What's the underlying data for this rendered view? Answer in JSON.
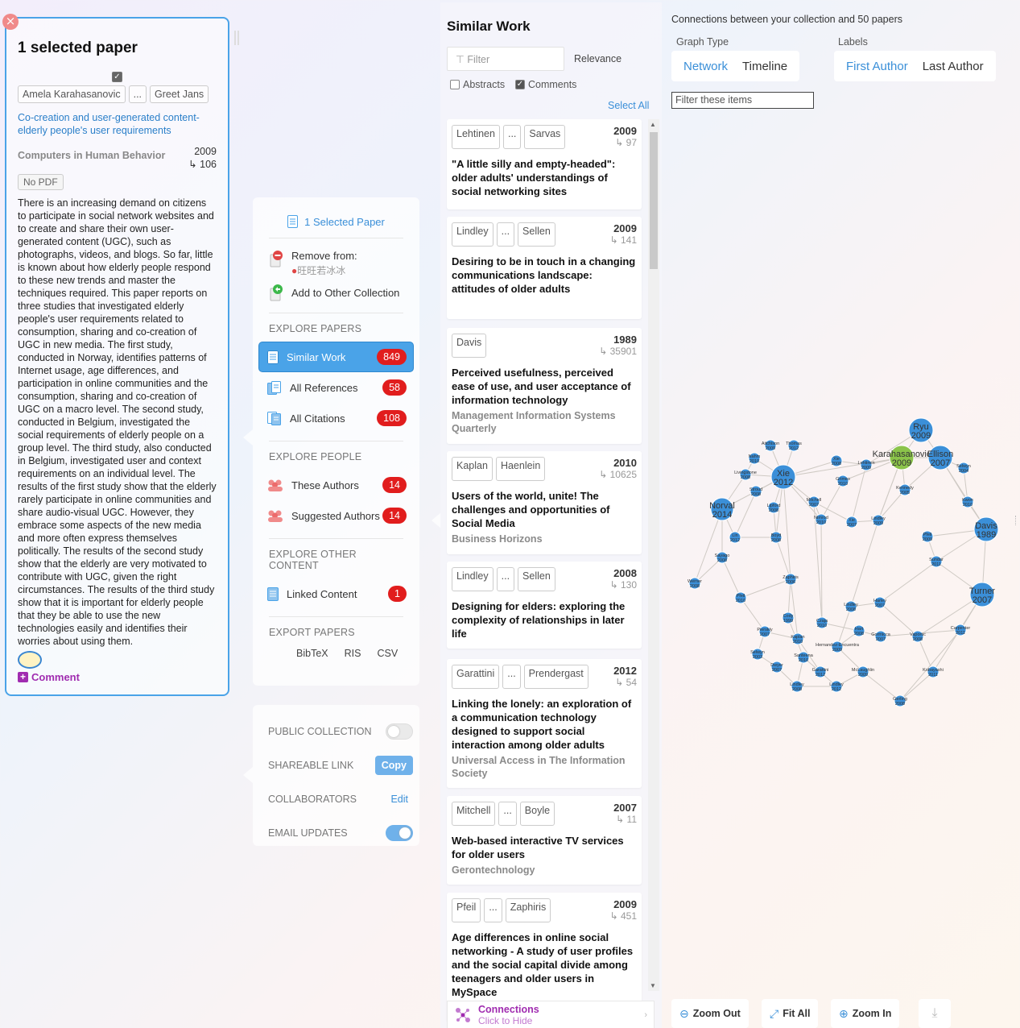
{
  "selected": {
    "title": "1 selected paper",
    "authors": [
      "Amela Karahasanovic",
      "...",
      "Greet Jans"
    ],
    "paper_title": "Co-creation and user-generated content-elderly people's user requirements",
    "journal": "Computers in Human Behavior",
    "year": "2009",
    "citations": "106",
    "no_pdf": "No PDF",
    "abstract": "There is an increasing demand on citizens to participate in social network websites and to create and share their own user-generated content (UGC), such as photographs, videos, and blogs. So far, little is known about how elderly people respond to these new trends and master the techniques required. This paper reports on three studies that investigated elderly people's user requirements related to consumption, sharing and co-creation of UGC in new media. The first study, conducted in Norway, identifies patterns of Internet usage, age differences, and participation in online communities and the consumption, sharing and co-creation of UGC on a macro level. The second study, conducted in Belgium, investigated the social requirements of elderly people on a group level. The third study, also conducted in Belgium, investigated user and context requirements on an individual level. The results of the first study show that the elderly rarely participate in online communities and share audio-visual UGC. However, they embrace some aspects of the new media and more often express themselves politically. The results of the second study show that the elderly are very motivated to contribute with UGC, given the right circumstances. The results of the third study show that it is important for elderly people that they be able to use the new technologies easily and identifies their worries about using them.",
    "comment_label": "Comment"
  },
  "menu": {
    "selected_paper": "1 Selected Paper",
    "remove_from": "Remove from:",
    "collection_name": "旺旺若冰冰",
    "add_to_other": "Add to Other Collection",
    "explore_papers_title": "EXPLORE PAPERS",
    "similar_work": {
      "label": "Similar Work",
      "count": "849"
    },
    "all_references": {
      "label": "All References",
      "count": "58"
    },
    "all_citations": {
      "label": "All Citations",
      "count": "108"
    },
    "explore_people_title": "EXPLORE PEOPLE",
    "these_authors": {
      "label": "These Authors",
      "count": "14"
    },
    "suggested_authors": {
      "label": "Suggested Authors",
      "count": "14"
    },
    "explore_other_title": "EXPLORE OTHER CONTENT",
    "linked_content": {
      "label": "Linked Content",
      "count": "1"
    },
    "export_title": "EXPORT PAPERS",
    "export_formats": [
      "BibTeX",
      "RIS",
      "CSV"
    ]
  },
  "settings": {
    "public_collection": "PUBLIC COLLECTION",
    "public_on": false,
    "shareable_link": "SHAREABLE LINK",
    "copy": "Copy",
    "collaborators": "COLLABORATORS",
    "edit": "Edit",
    "email_updates": "EMAIL UPDATES",
    "email_on": true
  },
  "similar": {
    "title": "Similar Work",
    "filter_placeholder": "Filter",
    "sort": "Relevance",
    "abstracts": "Abstracts",
    "abstracts_checked": false,
    "comments": "Comments",
    "comments_checked": true,
    "select_all": "Select All",
    "papers": [
      {
        "authors": [
          "Lehtinen",
          "...",
          "Sarvas"
        ],
        "year": "2009",
        "cites": "97",
        "title": "\"A little silly and empty-headed\": older adults' understandings of social networking sites",
        "journal": ""
      },
      {
        "authors": [
          "Lindley",
          "...",
          "Sellen"
        ],
        "year": "2009",
        "cites": "141",
        "title": "Desiring to be in touch in a changing communications landscape: attitudes of older adults",
        "journal": ""
      },
      {
        "authors": [
          "Davis"
        ],
        "year": "1989",
        "cites": "35901",
        "title": "Perceived usefulness, perceived ease of use, and user acceptance of information technology",
        "journal": "Management Information Systems Quarterly"
      },
      {
        "authors": [
          "Kaplan",
          "Haenlein"
        ],
        "year": "2010",
        "cites": "10625",
        "title": "Users of the world, unite! The challenges and opportunities of Social Media",
        "journal": "Business Horizons"
      },
      {
        "authors": [
          "Lindley",
          "...",
          "Sellen"
        ],
        "year": "2008",
        "cites": "130",
        "title": "Designing for elders: exploring the complexity of relationships in later life",
        "journal": ""
      },
      {
        "authors": [
          "Garattini",
          "...",
          "Prendergast"
        ],
        "year": "2012",
        "cites": "54",
        "title": "Linking the lonely: an exploration of a communication technology designed to support social interaction among older adults",
        "journal": "Universal Access in The Information Society"
      },
      {
        "authors": [
          "Mitchell",
          "...",
          "Boyle"
        ],
        "year": "2007",
        "cites": "11",
        "title": "Web-based interactive TV services for older users",
        "journal": "Gerontechnology"
      },
      {
        "authors": [
          "Pfeil",
          "...",
          "Zaphiris"
        ],
        "year": "2009",
        "cites": "451",
        "title": "Age differences in online social networking - A study of user profiles and the social capital divide among teenagers and older users in MySpace",
        "journal": ""
      }
    ],
    "connections_title": "Connections",
    "connections_sub": "Click to Hide"
  },
  "graph": {
    "caption": "Connections between your collection and 50 papers",
    "graph_type_label": "Graph Type",
    "graph_types": [
      "Network",
      "Timeline"
    ],
    "labels_label": "Labels",
    "label_options": [
      "First Author",
      "Last Author"
    ],
    "filter_placeholder": "Filter these items",
    "zoom_out": "Zoom Out",
    "fit_all": "Fit All",
    "zoom_in": "Zoom In",
    "colors": {
      "node": "#3b8fd8",
      "node_selected": "#8bc34a",
      "edge": "#cfcac4"
    },
    "nodes": [
      {
        "id": "ryu",
        "label": "Ryu",
        "year": "2009",
        "r": 15
      },
      {
        "id": "kara",
        "label": "Karahasanovic",
        "year": "2009",
        "r": 15,
        "selected": true
      },
      {
        "id": "ellison",
        "label": "Ellison",
        "year": "2007",
        "r": 15
      },
      {
        "id": "xie",
        "label": "Xie",
        "year": "2012",
        "r": 15
      },
      {
        "id": "norval",
        "label": "Norval",
        "year": "2014",
        "r": 14
      },
      {
        "id": "davis",
        "label": "Davis",
        "year": "1989",
        "r": 15
      },
      {
        "id": "turner",
        "label": "Turner",
        "year": "2007",
        "r": 15
      },
      {
        "id": "n1",
        "label": "Aitchison",
        "year": "2009",
        "r": 7
      },
      {
        "id": "n2",
        "label": "Thomas",
        "year": "2012",
        "r": 7
      },
      {
        "id": "n3",
        "label": "Nahm",
        "year": "2010",
        "r": 7
      },
      {
        "id": "n4",
        "label": "Livingstone",
        "year": "2008",
        "r": 7
      },
      {
        "id": "n5",
        "label": "Stroud",
        "year": "2008",
        "r": 7
      },
      {
        "id": "n6",
        "label": "Lipford",
        "year": "2008",
        "r": 7
      },
      {
        "id": "n7",
        "label": "Xie",
        "year": "2008",
        "r": 7
      },
      {
        "id": "n8",
        "label": "Lehtinen",
        "year": "2009",
        "r": 7
      },
      {
        "id": "n9",
        "label": "Grimes",
        "year": "2010",
        "r": 7
      },
      {
        "id": "n10",
        "label": "Selwyn",
        "year": "2004",
        "r": 7
      },
      {
        "id": "n11",
        "label": "Kennedy",
        "year": "2005",
        "r": 7
      },
      {
        "id": "n12",
        "label": "Mitchell",
        "year": "2007",
        "r": 7
      },
      {
        "id": "n13",
        "label": "Nimrod",
        "year": "2010",
        "r": 7
      },
      {
        "id": "n14",
        "label": "Kwon",
        "year": "2010",
        "r": 7
      },
      {
        "id": "n15",
        "label": "Xie",
        "year": "2007",
        "r": 7
      },
      {
        "id": "n16",
        "label": "Lindley",
        "year": "2009",
        "r": 7
      },
      {
        "id": "n17",
        "label": "Pfeil",
        "year": "2009",
        "r": 7
      },
      {
        "id": "n18",
        "label": "Lin",
        "year": "2012",
        "r": 7
      },
      {
        "id": "n19",
        "label": "Boyd",
        "year": "2008",
        "r": 7
      },
      {
        "id": "n20",
        "label": "Sayago",
        "year": "2008",
        "r": 7
      },
      {
        "id": "n21",
        "label": "Sundar",
        "year": "2011",
        "r": 7
      },
      {
        "id": "n22",
        "label": "Werner",
        "year": "2008",
        "r": 7
      },
      {
        "id": "n23",
        "label": "Pfeil",
        "year": "2010",
        "r": 7
      },
      {
        "id": "n24",
        "label": "Zaphiris",
        "year": "2006",
        "r": 7
      },
      {
        "id": "n25",
        "label": "Lindley",
        "year": "2008",
        "r": 7
      },
      {
        "id": "n26",
        "label": "Harley",
        "year": "2007",
        "r": 7
      },
      {
        "id": "n27",
        "label": "Cody",
        "year": "1999",
        "r": 7
      },
      {
        "id": "n28",
        "label": "Czaja",
        "year": "2010",
        "r": 7
      },
      {
        "id": "n29",
        "label": "Pierskly",
        "year": "2007",
        "r": 7
      },
      {
        "id": "n30",
        "label": "Hart",
        "year": "2008",
        "r": 7
      },
      {
        "id": "n31",
        "label": "Gormicca",
        "year": "2007",
        "r": 7
      },
      {
        "id": "n32",
        "label": "Vaportic",
        "year": "2008",
        "r": 7
      },
      {
        "id": "n33",
        "label": "Carpenter",
        "year": "2011",
        "r": 7
      },
      {
        "id": "n34",
        "label": "Kaplan",
        "year": "2010",
        "r": 7
      },
      {
        "id": "n35",
        "label": "Selwyn",
        "year": "2003",
        "r": 7
      },
      {
        "id": "n36",
        "label": "Santeena",
        "year": "2010",
        "r": 7
      },
      {
        "id": "n37",
        "label": "Hernandez-Encuentra",
        "year": "2009",
        "r": 7
      },
      {
        "id": "n38",
        "label": "Dwyer",
        "year": "2007",
        "r": 7
      },
      {
        "id": "n39",
        "label": "Garattini",
        "year": "2012",
        "r": 7
      },
      {
        "id": "n40",
        "label": "McLaughlin",
        "year": "2009",
        "r": 7
      },
      {
        "id": "n41",
        "label": "Kobayashi",
        "year": "2011",
        "r": 7
      },
      {
        "id": "n42",
        "label": "Lindley",
        "year": "2008",
        "r": 7
      },
      {
        "id": "n43",
        "label": "Lindley",
        "year": "2012",
        "r": 7
      },
      {
        "id": "n44",
        "label": "Gerling",
        "year": "2008",
        "r": 7
      },
      {
        "id": "n45",
        "label": "Sayago",
        "year": "2010",
        "r": 7
      },
      {
        "id": "n46",
        "label": "Cornejo",
        "year": "2013",
        "r": 7
      }
    ]
  }
}
